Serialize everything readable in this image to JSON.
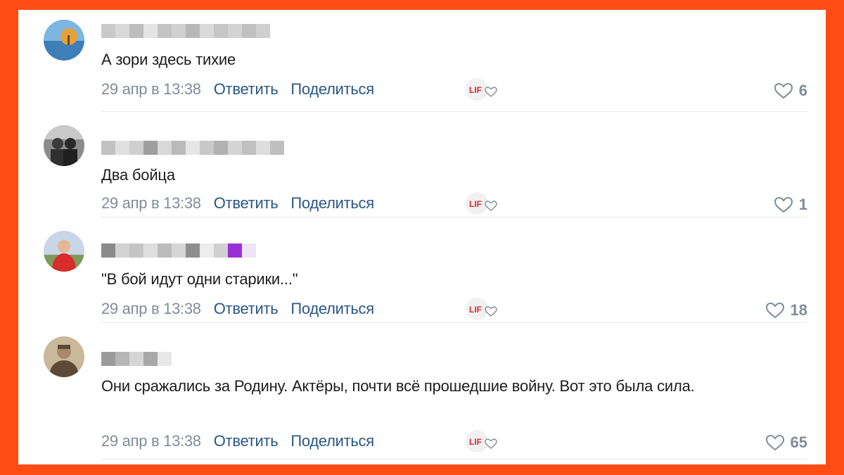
{
  "comments": [
    {
      "text": "А зори здесь тихие",
      "date": "29 апр в 13:38",
      "reply_label": "Ответить",
      "share_label": "Поделиться",
      "reaction_label": "LIF",
      "likes": "6",
      "avatar_colors": [
        "#6aa9d8",
        "#e5a13a",
        "#3f7fb8"
      ]
    },
    {
      "text": "Два бойца",
      "date": "29 апр в 13:38",
      "reply_label": "Ответить",
      "share_label": "Поделиться",
      "reaction_label": "LIF",
      "likes": "1",
      "avatar_colors": [
        "#2f2f2f",
        "#9a9a9a",
        "#5b5b5b"
      ]
    },
    {
      "text": "\"В бой идут одни старики...\"",
      "date": "29 апр в 13:38",
      "reply_label": "Ответить",
      "share_label": "Поделиться",
      "reaction_label": "LIF",
      "likes": "18",
      "avatar_colors": [
        "#c8d6e6",
        "#d92d2d",
        "#7e9a5a"
      ]
    },
    {
      "text": "Они сражались за Родину. Актёры, почти всё прошедшие войну. Вот это была сила.",
      "date": "29 апр в 13:38",
      "reply_label": "Ответить",
      "share_label": "Поделиться",
      "reaction_label": "LIF",
      "likes": "65",
      "avatar_colors": [
        "#8a7a62",
        "#5a4a36",
        "#c9b89a"
      ]
    }
  ],
  "colors": {
    "frame": "#fe4c12",
    "link": "#2a5885",
    "meta": "#818c99",
    "reaction_red": "#e0262e",
    "name_highlight": "#9b2fd6"
  }
}
